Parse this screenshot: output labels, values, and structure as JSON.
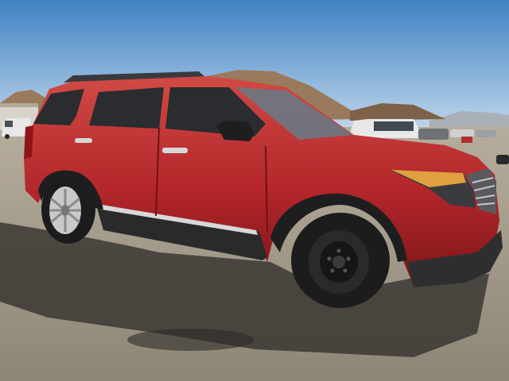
{
  "scene": {
    "subject": "car-photo",
    "colors": {
      "sky_top": "#3f82c4",
      "sky_horizon": "#c9dced",
      "hill": "#9a7a5c",
      "hill_dark": "#7e6149",
      "mountain_far": "#a9b0b8",
      "ground": "#b6ad9c",
      "ground_dark": "#8d8576",
      "shadow": "#3b3733",
      "car_body": "#b3262a",
      "car_body_light": "#d04a45",
      "car_body_dark": "#7a1518",
      "glass": "#2a2c30",
      "tire": "#1c1c1c",
      "steel_wheel": "#2a2a2a",
      "alloy_wheel": "#c9c9c9",
      "trim": "#d8d8d8",
      "headlight": "#e0a040",
      "van_white": "#e8e8e8"
    }
  }
}
